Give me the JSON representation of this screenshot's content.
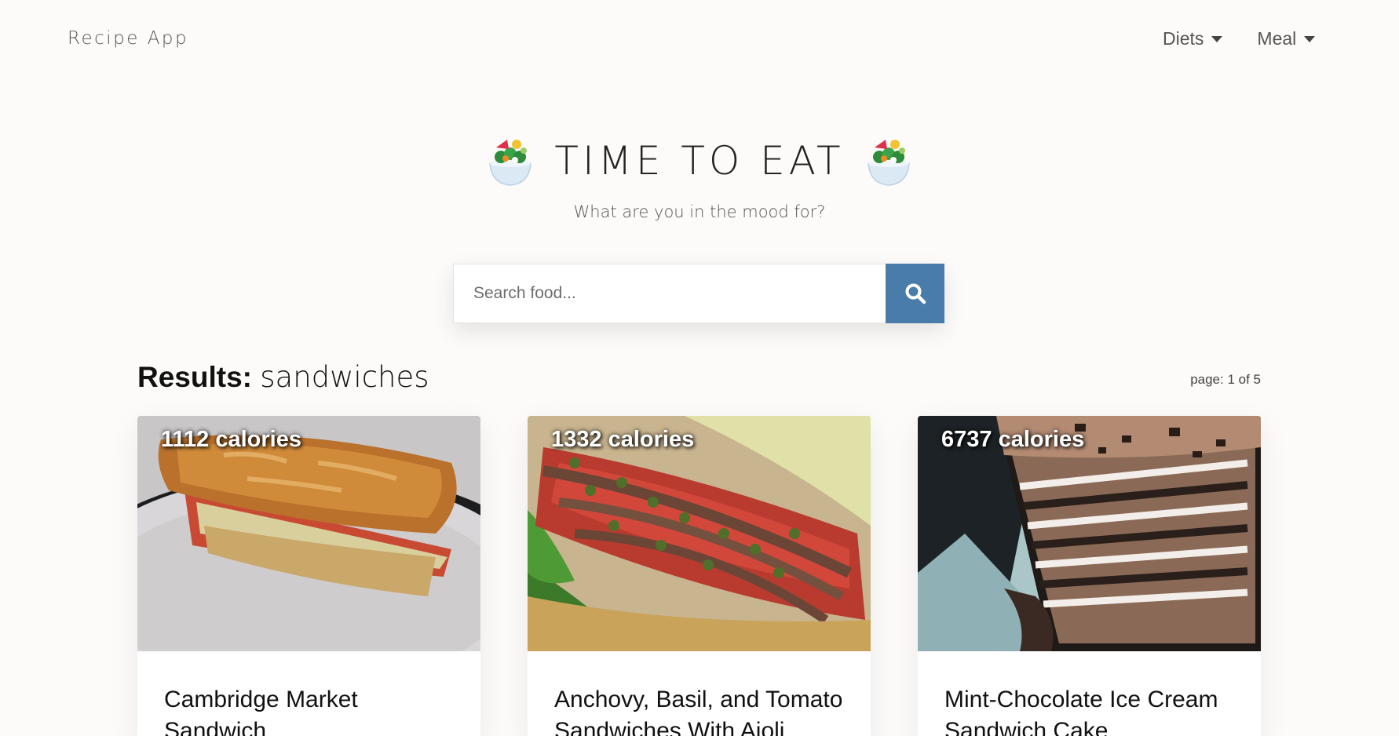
{
  "nav": {
    "brand": "Recipe App",
    "menu": [
      {
        "label": "Diets"
      },
      {
        "label": "Meal"
      }
    ]
  },
  "hero": {
    "title": "TIME TO EAT",
    "subtitle": "What are you in the mood for?",
    "icon": "green-salad-icon"
  },
  "search": {
    "placeholder": "Search food...",
    "value": "",
    "button_icon": "search-icon",
    "button_color": "#4a7ca9"
  },
  "results": {
    "label": "Results:",
    "query": "sandwiches",
    "page_info": "page: 1 of 5"
  },
  "cards": [
    {
      "calories": "1112 calories",
      "title": "Cambridge Market Sandwich"
    },
    {
      "calories": "1332 calories",
      "title": "Anchovy, Basil, and Tomato Sandwiches With Aioli"
    },
    {
      "calories": "6737 calories",
      "title": "Mint-Chocolate Ice Cream Sandwich Cake"
    }
  ]
}
